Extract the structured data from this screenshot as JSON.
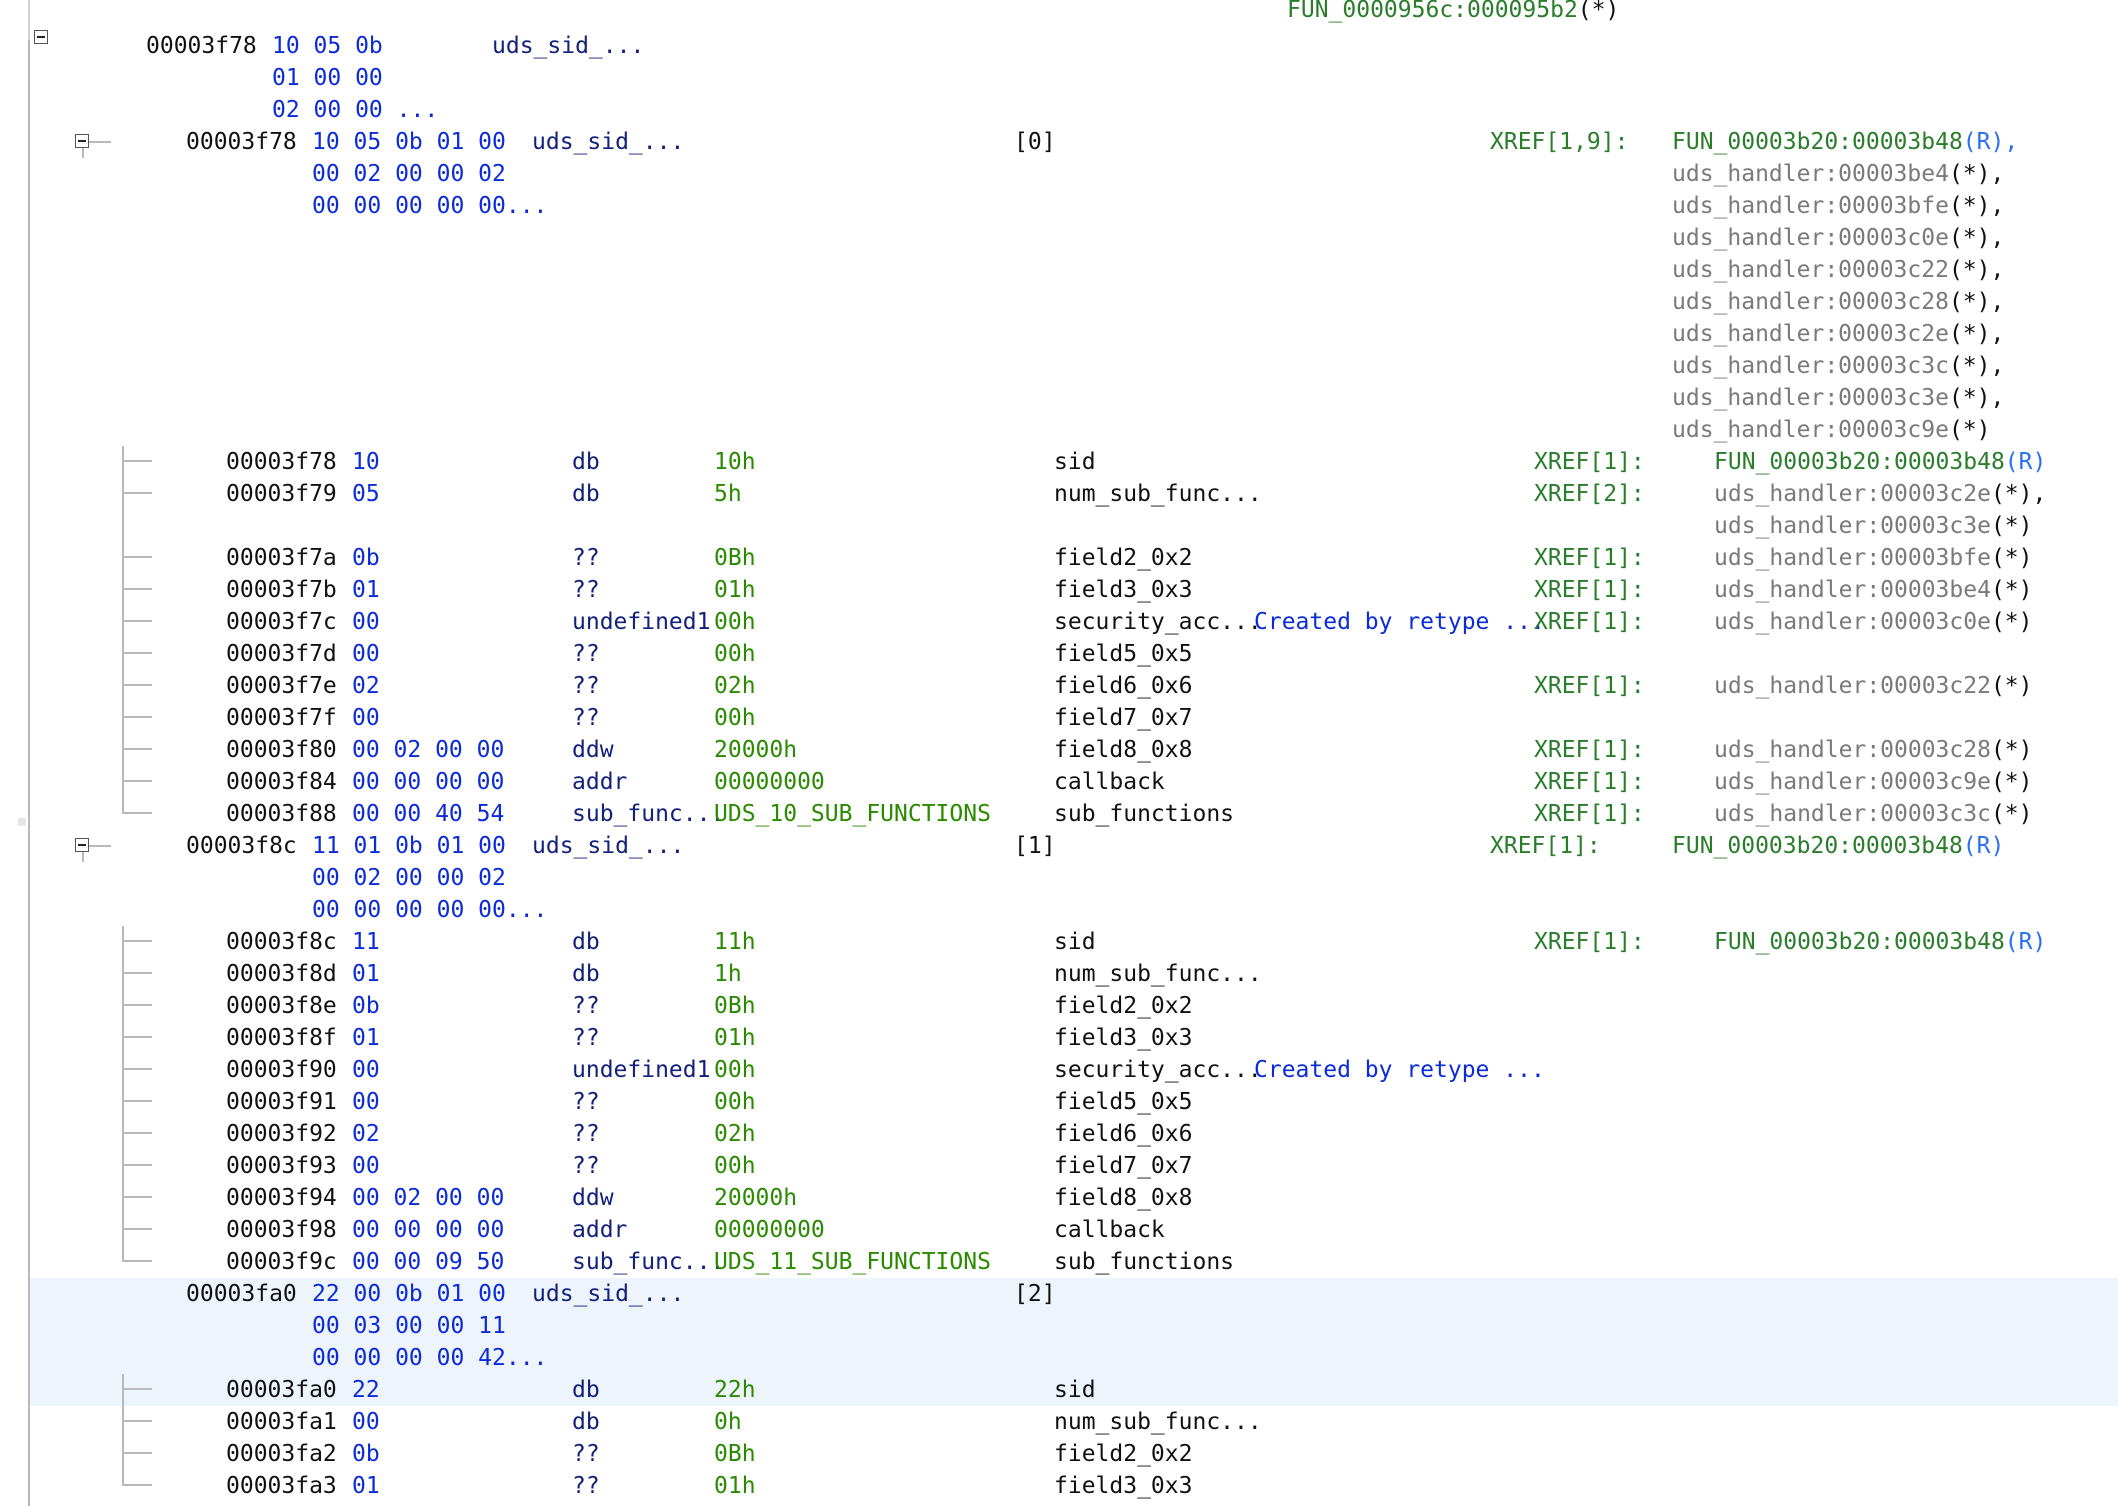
{
  "top_ref": {
    "text": "FUN_0000956c:000095b2",
    "suffix": "(*)"
  },
  "root_struct": {
    "address": "00003f78",
    "bytes": [
      "10 05 0b",
      "01 00 00",
      "02 00 00 ..."
    ],
    "label": "uds_sid_..."
  },
  "struct0": {
    "address": "00003f78",
    "bytes": [
      "10 05 0b 01 00",
      "00 02 00 00 02",
      "00 00 00 00 00..."
    ],
    "label": "uds_sid_...",
    "index": "[0]",
    "xref_label": "XREF[1,9]:",
    "xrefs": [
      {
        "text": "FUN_00003b20:00003b48",
        "suffix": "(R),"
      },
      {
        "text": "uds_handler:00003be4",
        "suffix": "(*),"
      },
      {
        "text": "uds_handler:00003bfe",
        "suffix": "(*),"
      },
      {
        "text": "uds_handler:00003c0e",
        "suffix": "(*),"
      },
      {
        "text": "uds_handler:00003c22",
        "suffix": "(*),"
      },
      {
        "text": "uds_handler:00003c28",
        "suffix": "(*),"
      },
      {
        "text": "uds_handler:00003c2e",
        "suffix": "(*),"
      },
      {
        "text": "uds_handler:00003c3c",
        "suffix": "(*),"
      },
      {
        "text": "uds_handler:00003c3e",
        "suffix": "(*),"
      },
      {
        "text": "uds_handler:00003c9e",
        "suffix": "(*)"
      }
    ],
    "fields": [
      {
        "address": "00003f78",
        "bytes": "10",
        "mnemonic": "db",
        "value": "10h",
        "name": "sid",
        "comment": "",
        "xref_label": "XREF[1]:",
        "xrefs": [
          {
            "text": "FUN_00003b20:00003b48",
            "suffix": "(R)"
          }
        ]
      },
      {
        "address": "00003f79",
        "bytes": "05",
        "mnemonic": "db",
        "value": "5h",
        "name": "num_sub_func...",
        "comment": "",
        "xref_label": "XREF[2]:",
        "xrefs": [
          {
            "text": "uds_handler:00003c2e",
            "suffix": "(*),"
          },
          {
            "text": "uds_handler:00003c3e",
            "suffix": "(*)"
          }
        ]
      },
      {
        "address": "00003f7a",
        "bytes": "0b",
        "mnemonic": "??",
        "value": "0Bh",
        "name": "field2_0x2",
        "comment": "",
        "xref_label": "XREF[1]:",
        "xrefs": [
          {
            "text": "uds_handler:00003bfe",
            "suffix": "(*)"
          }
        ]
      },
      {
        "address": "00003f7b",
        "bytes": "01",
        "mnemonic": "??",
        "value": "01h",
        "name": "field3_0x3",
        "comment": "",
        "xref_label": "XREF[1]:",
        "xrefs": [
          {
            "text": "uds_handler:00003be4",
            "suffix": "(*)"
          }
        ]
      },
      {
        "address": "00003f7c",
        "bytes": "00",
        "mnemonic": "undefined1",
        "value": "00h",
        "name": "security_acc...",
        "comment": "Created by retype ...",
        "xref_label": "XREF[1]:",
        "xrefs": [
          {
            "text": "uds_handler:00003c0e",
            "suffix": "(*)"
          }
        ]
      },
      {
        "address": "00003f7d",
        "bytes": "00",
        "mnemonic": "??",
        "value": "00h",
        "name": "field5_0x5",
        "comment": "",
        "xref_label": "",
        "xrefs": []
      },
      {
        "address": "00003f7e",
        "bytes": "02",
        "mnemonic": "??",
        "value": "02h",
        "name": "field6_0x6",
        "comment": "",
        "xref_label": "XREF[1]:",
        "xrefs": [
          {
            "text": "uds_handler:00003c22",
            "suffix": "(*)"
          }
        ]
      },
      {
        "address": "00003f7f",
        "bytes": "00",
        "mnemonic": "??",
        "value": "00h",
        "name": "field7_0x7",
        "comment": "",
        "xref_label": "",
        "xrefs": []
      },
      {
        "address": "00003f80",
        "bytes": "00 02 00 00",
        "mnemonic": "ddw",
        "value": "20000h",
        "name": "field8_0x8",
        "comment": "",
        "xref_label": "XREF[1]:",
        "xrefs": [
          {
            "text": "uds_handler:00003c28",
            "suffix": "(*)"
          }
        ]
      },
      {
        "address": "00003f84",
        "bytes": "00 00 00 00",
        "mnemonic": "addr",
        "value": "00000000",
        "name": "callback",
        "comment": "",
        "xref_label": "XREF[1]:",
        "xrefs": [
          {
            "text": "uds_handler:00003c9e",
            "suffix": "(*)"
          }
        ]
      },
      {
        "address": "00003f88",
        "bytes": "00 00 40 54",
        "mnemonic": "sub_func...",
        "value": "UDS_10_SUB_FUNCTIONS",
        "name": "sub_functions",
        "comment": "",
        "xref_label": "XREF[1]:",
        "xrefs": [
          {
            "text": "uds_handler:00003c3c",
            "suffix": "(*)"
          }
        ]
      }
    ]
  },
  "struct1": {
    "address": "00003f8c",
    "bytes": [
      "11 01 0b 01 00",
      "00 02 00 00 02",
      "00 00 00 00 00..."
    ],
    "label": "uds_sid_...",
    "index": "[1]",
    "xref_label": "XREF[1]:",
    "xrefs": [
      {
        "text": "FUN_00003b20:00003b48",
        "suffix": "(R)"
      }
    ],
    "fields": [
      {
        "address": "00003f8c",
        "bytes": "11",
        "mnemonic": "db",
        "value": "11h",
        "name": "sid",
        "comment": "",
        "xref_label": "XREF[1]:",
        "xrefs": [
          {
            "text": "FUN_00003b20:00003b48",
            "suffix": "(R)"
          }
        ]
      },
      {
        "address": "00003f8d",
        "bytes": "01",
        "mnemonic": "db",
        "value": "1h",
        "name": "num_sub_func...",
        "comment": "",
        "xref_label": "",
        "xrefs": []
      },
      {
        "address": "00003f8e",
        "bytes": "0b",
        "mnemonic": "??",
        "value": "0Bh",
        "name": "field2_0x2",
        "comment": "",
        "xref_label": "",
        "xrefs": []
      },
      {
        "address": "00003f8f",
        "bytes": "01",
        "mnemonic": "??",
        "value": "01h",
        "name": "field3_0x3",
        "comment": "",
        "xref_label": "",
        "xrefs": []
      },
      {
        "address": "00003f90",
        "bytes": "00",
        "mnemonic": "undefined1",
        "value": "00h",
        "name": "security_acc...",
        "comment": "Created by retype ...",
        "xref_label": "",
        "xrefs": []
      },
      {
        "address": "00003f91",
        "bytes": "00",
        "mnemonic": "??",
        "value": "00h",
        "name": "field5_0x5",
        "comment": "",
        "xref_label": "",
        "xrefs": []
      },
      {
        "address": "00003f92",
        "bytes": "02",
        "mnemonic": "??",
        "value": "02h",
        "name": "field6_0x6",
        "comment": "",
        "xref_label": "",
        "xrefs": []
      },
      {
        "address": "00003f93",
        "bytes": "00",
        "mnemonic": "??",
        "value": "00h",
        "name": "field7_0x7",
        "comment": "",
        "xref_label": "",
        "xrefs": []
      },
      {
        "address": "00003f94",
        "bytes": "00 02 00 00",
        "mnemonic": "ddw",
        "value": "20000h",
        "name": "field8_0x8",
        "comment": "",
        "xref_label": "",
        "xrefs": []
      },
      {
        "address": "00003f98",
        "bytes": "00 00 00 00",
        "mnemonic": "addr",
        "value": "00000000",
        "name": "callback",
        "comment": "",
        "xref_label": "",
        "xrefs": []
      },
      {
        "address": "00003f9c",
        "bytes": "00 00 09 50",
        "mnemonic": "sub_func...",
        "value": "UDS_11_SUB_FUNCTIONS",
        "name": "sub_functions",
        "comment": "",
        "xref_label": "",
        "xrefs": []
      }
    ]
  },
  "struct2": {
    "address": "00003fa0",
    "bytes": [
      "22 00 0b 01 00",
      "00 03 00 00 11",
      "00 00 00 00 42..."
    ],
    "label": "uds_sid_...",
    "index": "[2]",
    "fields": [
      {
        "address": "00003fa0",
        "bytes": "22",
        "mnemonic": "db",
        "value": "22h",
        "name": "sid",
        "comment": "",
        "xref_label": "",
        "xrefs": []
      },
      {
        "address": "00003fa1",
        "bytes": "00",
        "mnemonic": "db",
        "value": "0h",
        "name": "num_sub_func...",
        "comment": "",
        "xref_label": "",
        "xrefs": []
      },
      {
        "address": "00003fa2",
        "bytes": "0b",
        "mnemonic": "??",
        "value": "0Bh",
        "name": "field2_0x2",
        "comment": "",
        "xref_label": "",
        "xrefs": []
      },
      {
        "address": "00003fa3",
        "bytes": "01",
        "mnemonic": "??",
        "value": "01h",
        "name": "field3_0x3",
        "comment": "",
        "xref_label": "",
        "xrefs": []
      }
    ]
  },
  "colors": {
    "bytes": "#0b2bd8",
    "values": "#2a8a00",
    "xref": "#2a7d2a",
    "mnemonic": "#13217a",
    "selection_bg": "#eef4fb",
    "selection_marker": "#e5362b"
  }
}
